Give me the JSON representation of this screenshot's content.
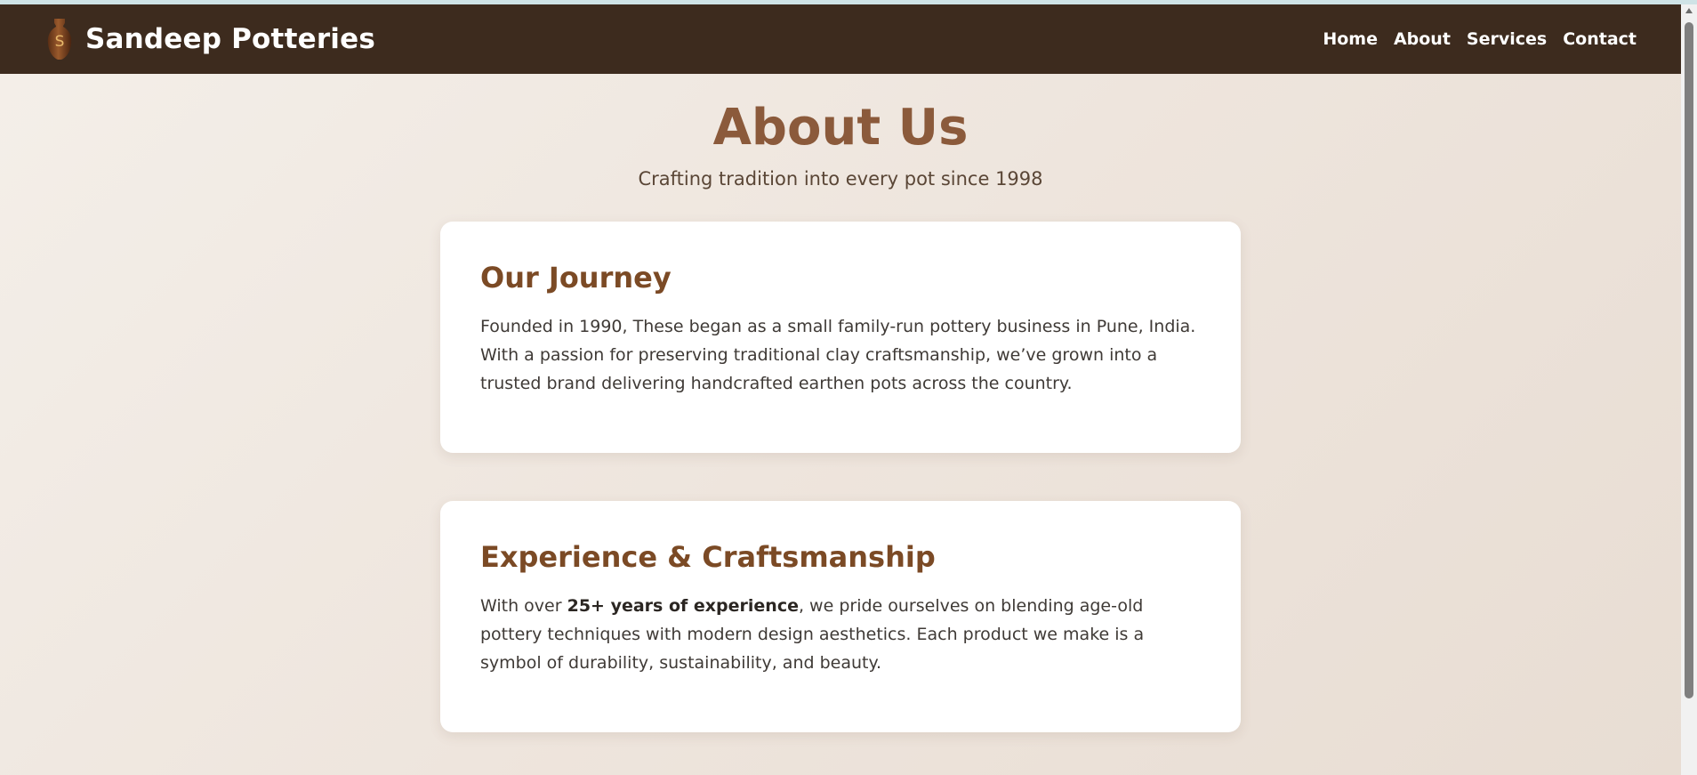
{
  "header": {
    "brand_name": "Sandeep Potteries",
    "logo_icon": "vase-logo-icon",
    "logo_letter": "S",
    "nav": [
      {
        "label": "Home"
      },
      {
        "label": "About"
      },
      {
        "label": "Services"
      },
      {
        "label": "Contact"
      }
    ]
  },
  "hero": {
    "title": "About Us",
    "subtitle": "Crafting tradition into every pot since 1998"
  },
  "cards": [
    {
      "title": "Our Journey",
      "text": "Founded in 1990, These began as a small family-run pottery business in Pune, India. With a passion for preserving traditional clay craftsmanship, we’ve grown into a trusted brand delivering handcrafted earthen pots across the country."
    },
    {
      "title": "Experience & Craftsmanship",
      "text_before": "With over ",
      "text_bold": "25+ years of experience",
      "text_after": ", we pride ourselves on blending age-old pottery techniques with modern design aesthetics. Each product we make is a symbol of durability, sustainability, and beauty."
    }
  ],
  "colors": {
    "navbar": "#3d2b1e",
    "title": "#8b5a3b",
    "card_title": "#7b4a25",
    "background": "#f2ebe4"
  }
}
